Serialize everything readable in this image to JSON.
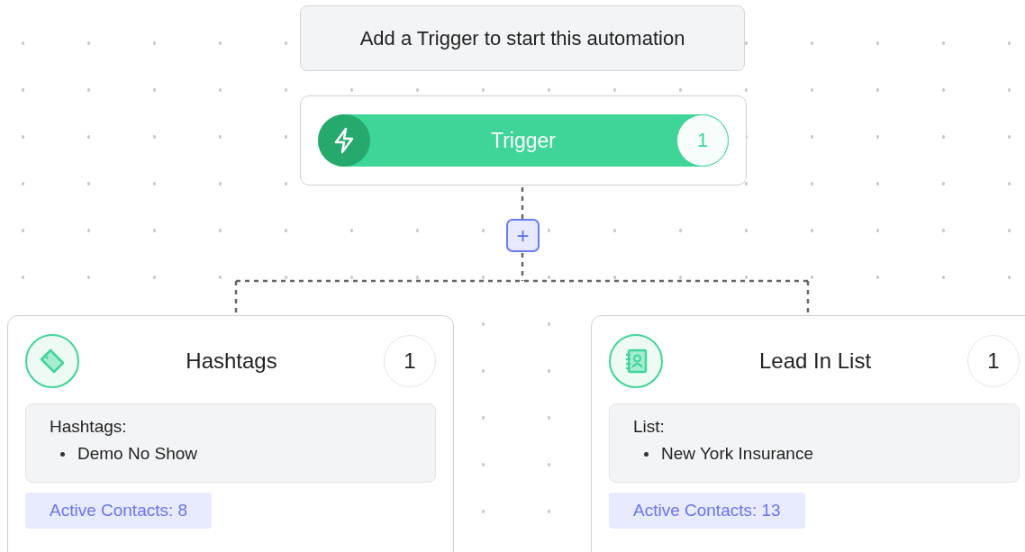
{
  "prompt": {
    "text": "Add a Trigger to start this automation"
  },
  "trigger": {
    "label": "Trigger",
    "count": "1"
  },
  "add_button": {
    "label": "+"
  },
  "branches": [
    {
      "kind": "tag",
      "title": "Hashtags",
      "count": "1",
      "section_label": "Hashtags:",
      "items": [
        "Demo No Show"
      ],
      "active_contacts": "Active Contacts: 8"
    },
    {
      "kind": "contact-book",
      "title": "Lead In List",
      "count": "1",
      "section_label": "List:",
      "items": [
        "New York Insurance"
      ],
      "active_contacts": "Active Contacts: 13"
    }
  ]
}
